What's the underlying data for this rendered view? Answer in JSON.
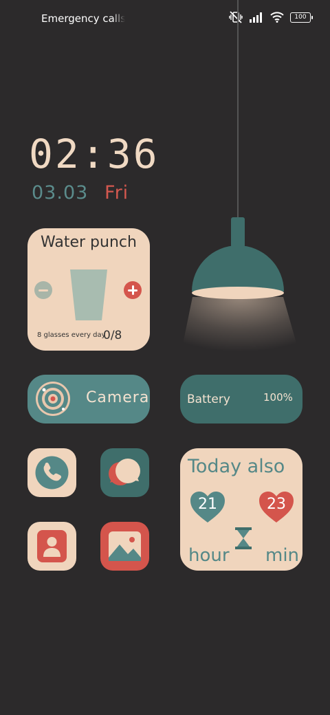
{
  "status_bar": {
    "carrier_text": "Emergency calls only",
    "battery": "100"
  },
  "clock": {
    "time": "02:36",
    "date": "03.03",
    "day": "Fri"
  },
  "water_widget": {
    "title": "Water punch",
    "goal_label": "8 glasses every day",
    "count": "0/8"
  },
  "camera_widget": {
    "label": "Camera"
  },
  "battery_widget": {
    "label": "Battery",
    "value": "100%"
  },
  "apps": [
    {
      "name": "phone",
      "icon": "phone-icon"
    },
    {
      "name": "messages",
      "icon": "chat-bubbles-icon"
    },
    {
      "name": "contacts",
      "icon": "contact-icon"
    },
    {
      "name": "gallery",
      "icon": "picture-icon"
    }
  ],
  "today_widget": {
    "title": "Today also",
    "hours": "21",
    "minutes": "23",
    "hour_label": "hour",
    "min_label": "min"
  },
  "colors": {
    "background": "#2c2a2b",
    "cream": "#f0d5bd",
    "teal": "#558887",
    "dark_teal": "#3f6e6b",
    "red": "#d4554c"
  }
}
